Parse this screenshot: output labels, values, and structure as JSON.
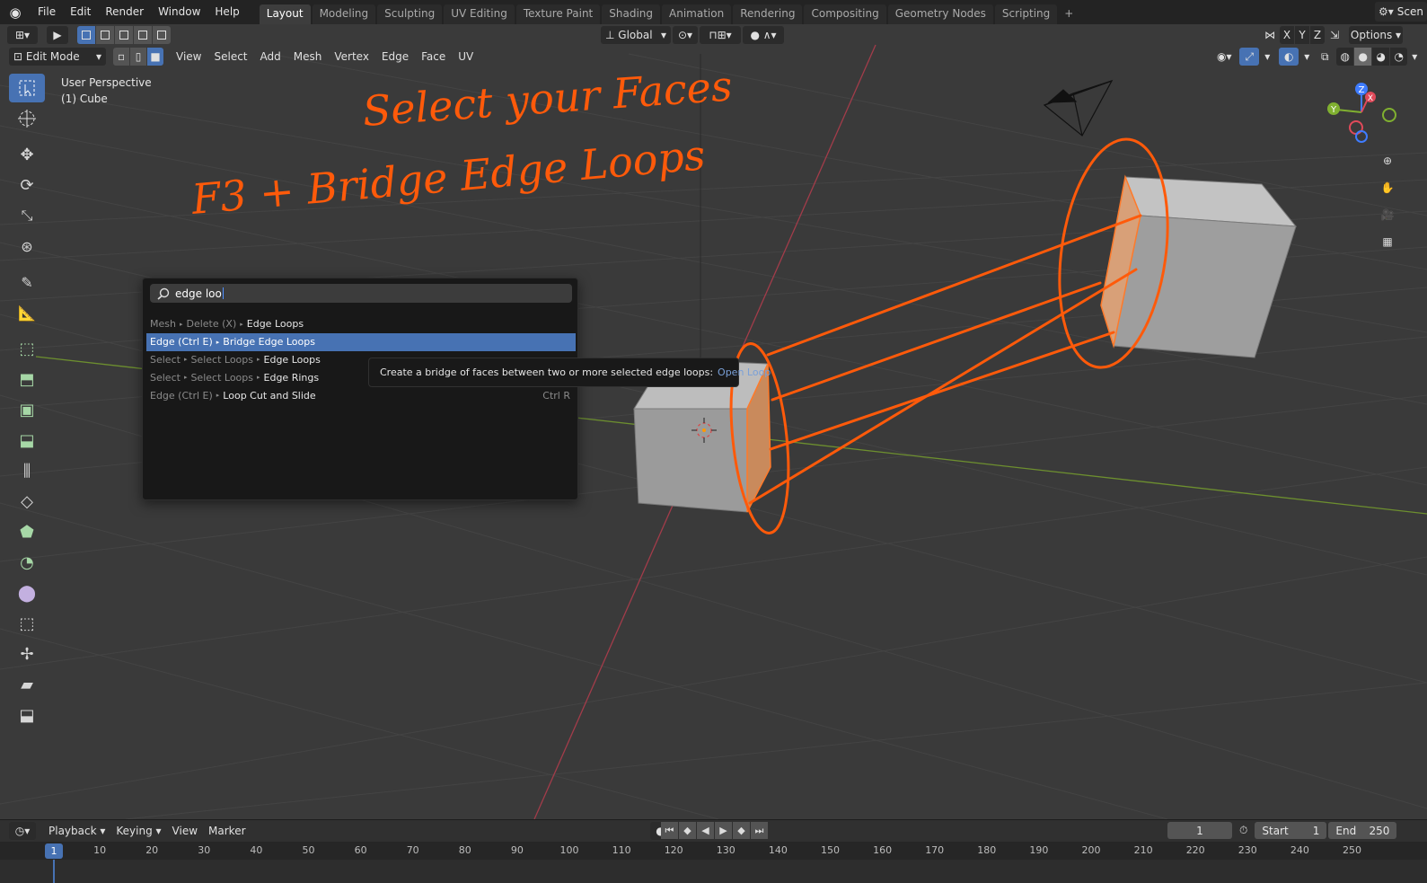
{
  "topbar": {
    "menus": [
      "File",
      "Edit",
      "Render",
      "Window",
      "Help"
    ],
    "workspaces": [
      "Layout",
      "Modeling",
      "Sculpting",
      "UV Editing",
      "Texture Paint",
      "Shading",
      "Animation",
      "Rendering",
      "Compositing",
      "Geometry Nodes",
      "Scripting"
    ],
    "active_workspace": "Layout",
    "scene_label": "Scen"
  },
  "header": {
    "transform_orientation": "Global",
    "options_label": "Options",
    "axis_labels": [
      "X",
      "Y",
      "Z"
    ],
    "mode": "Edit Mode",
    "menus": [
      "View",
      "Select",
      "Add",
      "Mesh",
      "Vertex",
      "Edge",
      "Face",
      "UV"
    ]
  },
  "viewport": {
    "perspective": "User Perspective",
    "object": "(1) Cube",
    "gizmo_axes": {
      "x": "X",
      "y": "Y",
      "z": "Z"
    }
  },
  "annotations": {
    "line1": "Select your Faces",
    "line2": "F3 + Bridge Edge Loops",
    "color": "#ff5a0a"
  },
  "search": {
    "query": "edge loo",
    "results": [
      {
        "path": [
          "Mesh",
          "Delete (X)"
        ],
        "name": "Edge Loops",
        "shortcut": "",
        "highlighted": false
      },
      {
        "path": [
          "Edge (Ctrl E)"
        ],
        "name": "Bridge Edge Loops",
        "shortcut": "",
        "highlighted": true
      },
      {
        "path": [
          "Select",
          "Select Loops"
        ],
        "name": "Edge Loops",
        "shortcut": "",
        "highlighted": false
      },
      {
        "path": [
          "Select",
          "Select Loops"
        ],
        "name": "Edge Rings",
        "shortcut": "",
        "highlighted": false
      },
      {
        "path": [
          "Edge (Ctrl E)"
        ],
        "name": "Loop Cut and Slide",
        "shortcut": "Ctrl R",
        "highlighted": false
      }
    ]
  },
  "tooltip": {
    "text": "Create a bridge of faces between two or more selected edge loops:",
    "python": "Open Loop"
  },
  "timeline": {
    "menus": [
      "Playback",
      "Keying",
      "View",
      "Marker"
    ],
    "current_frame": "1",
    "start_label": "Start",
    "start_value": "1",
    "end_label": "End",
    "end_value": "250",
    "ruler_current": "1",
    "ruler_ticks": [
      "10",
      "20",
      "30",
      "40",
      "50",
      "60",
      "70",
      "80",
      "90",
      "100",
      "110",
      "120",
      "130",
      "140",
      "150",
      "160",
      "170",
      "180",
      "190",
      "200",
      "210",
      "220",
      "230",
      "240",
      "250"
    ]
  }
}
